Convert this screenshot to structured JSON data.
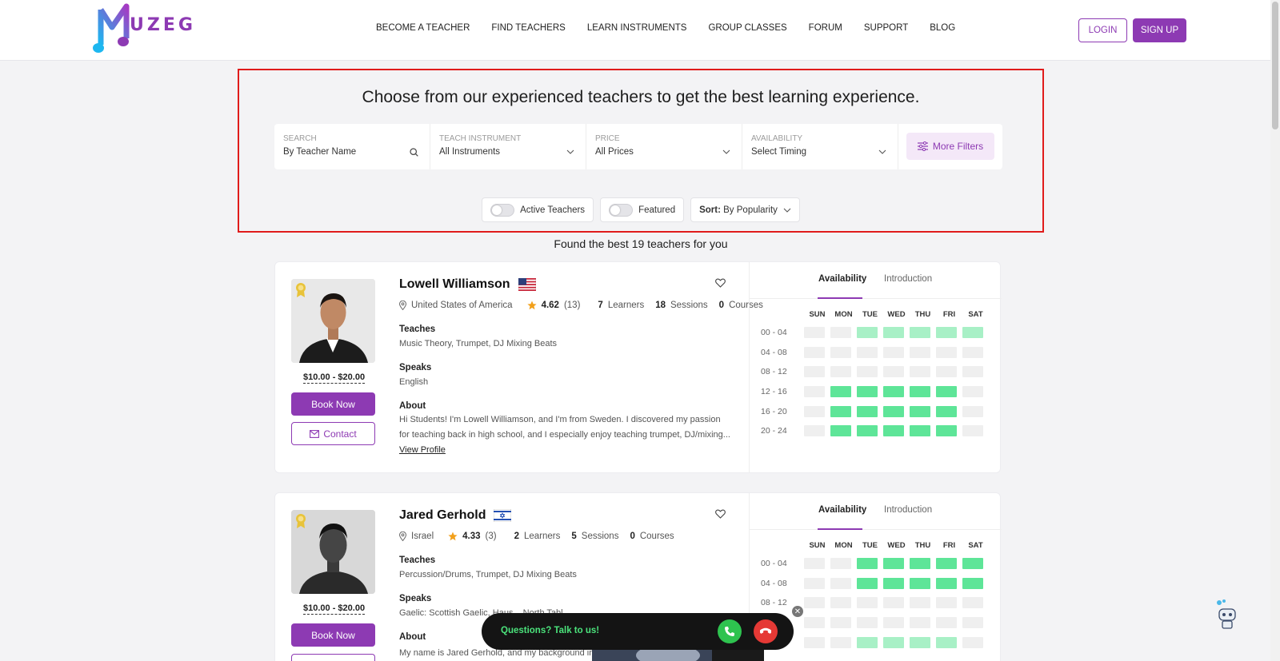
{
  "header": {
    "logo_text": "UZEG",
    "nav": [
      "BECOME A TEACHER",
      "FIND TEACHERS",
      "LEARN INSTRUMENTS",
      "GROUP CLASSES",
      "FORUM",
      "SUPPORT",
      "BLOG"
    ],
    "login_label": "LOGIN",
    "signup_label": "SIGN UP"
  },
  "colors": {
    "brand": "#8d3ab3",
    "highlight_border": "#e01b1b",
    "slot_on": "#5ee598",
    "slot_light": "#a8f0c6",
    "slot_off": "#efefef"
  },
  "filters": {
    "title": "Choose from our experienced teachers to get the best learning experience.",
    "search": {
      "label": "SEARCH",
      "value": "By Teacher Name"
    },
    "instrument": {
      "label": "TEACH INSTRUMENT",
      "value": "All Instruments"
    },
    "price": {
      "label": "PRICE",
      "value": "All Prices"
    },
    "availability": {
      "label": "AVAILABILITY",
      "value": "Select Timing"
    },
    "more_filters_label": "More Filters",
    "active_teachers_label": "Active Teachers",
    "featured_label": "Featured",
    "sort_prefix": "Sort:",
    "sort_value": "By Popularity"
  },
  "results_text": "Found the best 19 teachers for you",
  "teachers": [
    {
      "name": "Lowell Williamson",
      "flag": "us-flag",
      "location": "United States of America",
      "rating": "4.62",
      "reviews": "(13)",
      "learners": "7",
      "sessions": "18",
      "courses": "0",
      "teaches_label": "Teaches",
      "teaches": "Music Theory, Trumpet, DJ Mixing Beats",
      "speaks_label": "Speaks",
      "speaks": "English",
      "about_label": "About",
      "about": "Hi Students! I'm Lowell Williamson, and I'm from Sweden. I discovered my passion for teaching back in high school, and I especially enjoy teaching trumpet, DJ/mixing...",
      "view_profile": "View Profile",
      "price": "$10.00 - $20.00",
      "book_label": "Book Now",
      "contact_label": "Contact"
    },
    {
      "name": "Jared Gerhold",
      "flag": "israel-flag",
      "location": "Israel",
      "rating": "4.33",
      "reviews": "(3)",
      "learners": "2",
      "sessions": "5",
      "courses": "0",
      "teaches_label": "Teaches",
      "teaches": "Percussion/Drums, Trumpet, DJ Mixing Beats",
      "speaks_label": "Speaks",
      "speaks": "Gaelic: Scottish Gaelic, Haus... North Tabl...",
      "about_label": "About",
      "about": "My name is Jared Gerhold, and my background in",
      "price": "$10.00 - $20.00",
      "book_label": "Book Now"
    }
  ],
  "stats_labels": {
    "learners": "Learners",
    "sessions": "Sessions",
    "courses": "Courses"
  },
  "availability": {
    "tab_availability": "Availability",
    "tab_introduction": "Introduction",
    "days": [
      "SUN",
      "MON",
      "TUE",
      "WED",
      "THU",
      "FRI",
      "SAT"
    ],
    "slots": [
      "00 - 04",
      "04 - 08",
      "08 - 12",
      "12 - 16",
      "16 - 20",
      "20 - 24"
    ]
  },
  "call_widget": {
    "text": "Questions? Talk to us!"
  }
}
